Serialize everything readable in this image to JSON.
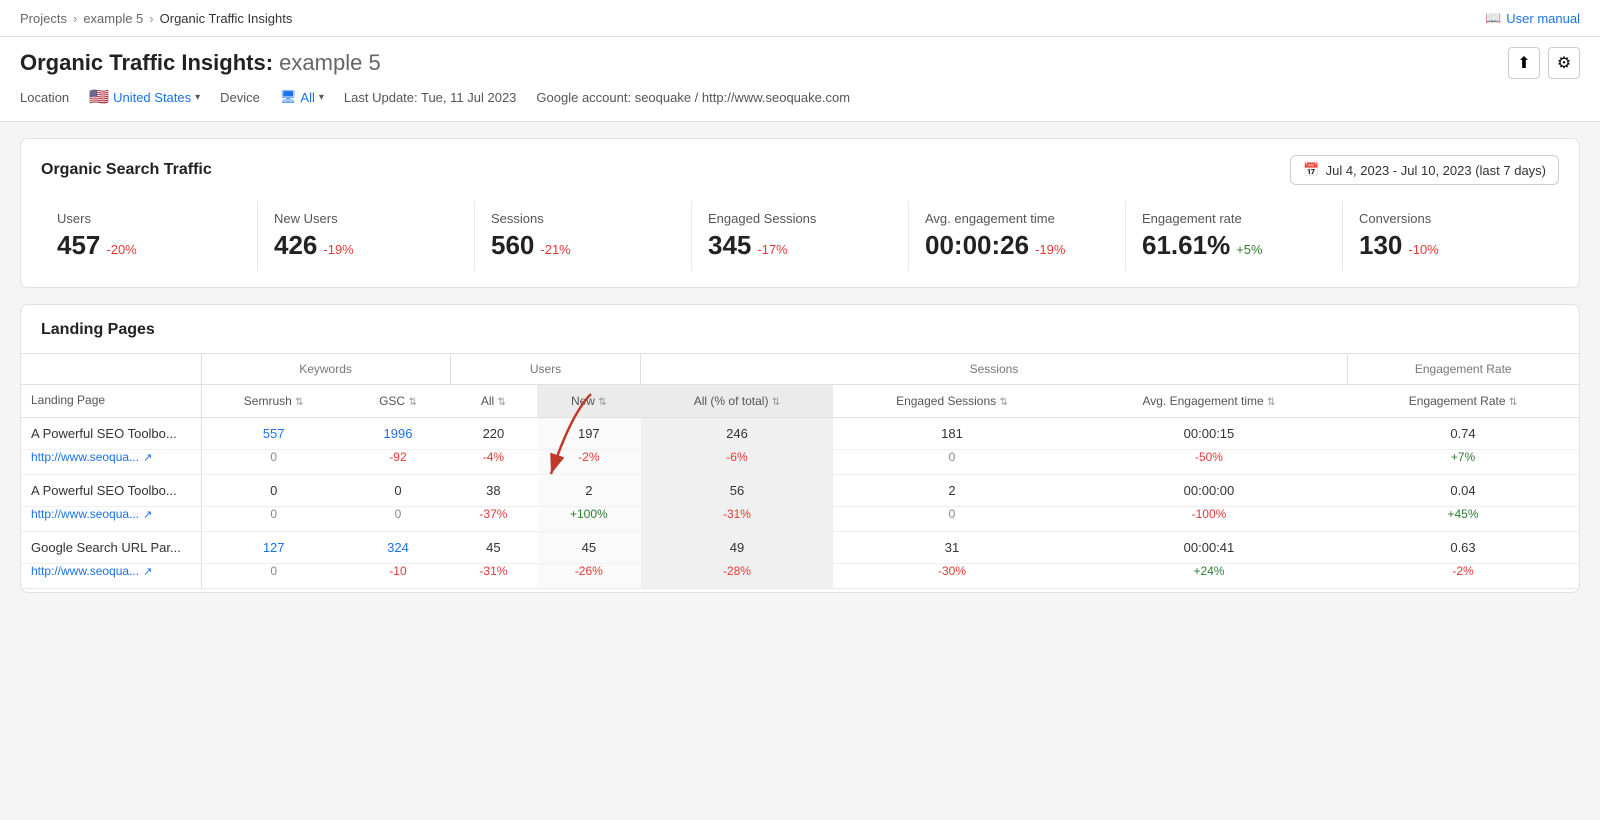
{
  "breadcrumb": {
    "projects": "Projects",
    "project": "example 5",
    "current": "Organic Traffic Insights",
    "sep": ">"
  },
  "user_manual": "User manual",
  "page_title": "Organic Traffic Insights:",
  "project_name": "example 5",
  "location_label": "Location",
  "location_value": "United States",
  "device_label": "Device",
  "device_value": "All",
  "last_update": "Last Update: Tue, 11 Jul 2023",
  "google_account": "Google account: seoquake / http://www.seoquake.com",
  "organic_traffic_title": "Organic Search Traffic",
  "date_range": "Jul 4, 2023 - Jul 10, 2023 (last 7 days)",
  "metrics": [
    {
      "label": "Users",
      "value": "457",
      "change": "-20%",
      "change_type": "neg"
    },
    {
      "label": "New Users",
      "value": "426",
      "change": "-19%",
      "change_type": "neg"
    },
    {
      "label": "Sessions",
      "value": "560",
      "change": "-21%",
      "change_type": "neg"
    },
    {
      "label": "Engaged Sessions",
      "value": "345",
      "change": "-17%",
      "change_type": "neg"
    },
    {
      "label": "Avg. engagement time",
      "value": "00:00:26",
      "change": "-19%",
      "change_type": "neg"
    },
    {
      "label": "Engagement rate",
      "value": "61.61%",
      "change": "+5%",
      "change_type": "pos"
    },
    {
      "label": "Conversions",
      "value": "130",
      "change": "-10%",
      "change_type": "neg"
    }
  ],
  "landing_pages_title": "Landing Pages",
  "table": {
    "col_groups": [
      {
        "label": "",
        "colspan": 1
      },
      {
        "label": "Keywords",
        "colspan": 2
      },
      {
        "label": "Users",
        "colspan": 2
      },
      {
        "label": "Sessions",
        "colspan": 3
      },
      {
        "label": "Engagement Rate",
        "colspan": 1
      }
    ],
    "headers": [
      "Landing Page",
      "Semrush",
      "GSC",
      "All",
      "New",
      "All (% of total)",
      "Engaged Sessions",
      "Avg. Engagement time",
      "Engagement Rate"
    ],
    "rows": [
      {
        "name": "A Powerful SEO Toolbo...",
        "url": "http://www.seoqua...",
        "semrush_val": "557",
        "semrush_sub": "0",
        "gsc_val": "1996",
        "gsc_sub": "-92",
        "users_all_val": "220",
        "users_all_sub": "-4%",
        "users_new_val": "197",
        "users_new_sub": "-2%",
        "sessions_all_val": "246",
        "sessions_all_sub": "-6%",
        "engaged_val": "181",
        "engaged_sub": "0",
        "avg_time_val": "00:00:15",
        "avg_time_sub": "-50%",
        "eng_rate_val": "0.74",
        "eng_rate_sub": "+7%",
        "semrush_link": true,
        "gsc_link": true
      },
      {
        "name": "A Powerful SEO Toolbo...",
        "url": "http://www.seoqua...",
        "semrush_val": "0",
        "semrush_sub": "0",
        "gsc_val": "0",
        "gsc_sub": "0",
        "users_all_val": "38",
        "users_all_sub": "-37%",
        "users_new_val": "2",
        "users_new_sub": "+100%",
        "sessions_all_val": "56",
        "sessions_all_sub": "-31%",
        "engaged_val": "2",
        "engaged_sub": "0",
        "avg_time_val": "00:00:00",
        "avg_time_sub": "-100%",
        "eng_rate_val": "0.04",
        "eng_rate_sub": "+45%",
        "semrush_link": false,
        "gsc_link": false
      },
      {
        "name": "Google Search URL Par...",
        "url": "http://www.seoqua...",
        "semrush_val": "127",
        "semrush_sub": "0",
        "gsc_val": "324",
        "gsc_sub": "-10",
        "users_all_val": "45",
        "users_all_sub": "-31%",
        "users_new_val": "45",
        "users_new_sub": "-26%",
        "sessions_all_val": "49",
        "sessions_all_sub": "-28%",
        "engaged_val": "31",
        "engaged_sub": "-30%",
        "avg_time_val": "00:00:41",
        "avg_time_sub": "+24%",
        "eng_rate_val": "0.63",
        "eng_rate_sub": "-2%",
        "semrush_link": true,
        "gsc_link": true
      }
    ]
  }
}
